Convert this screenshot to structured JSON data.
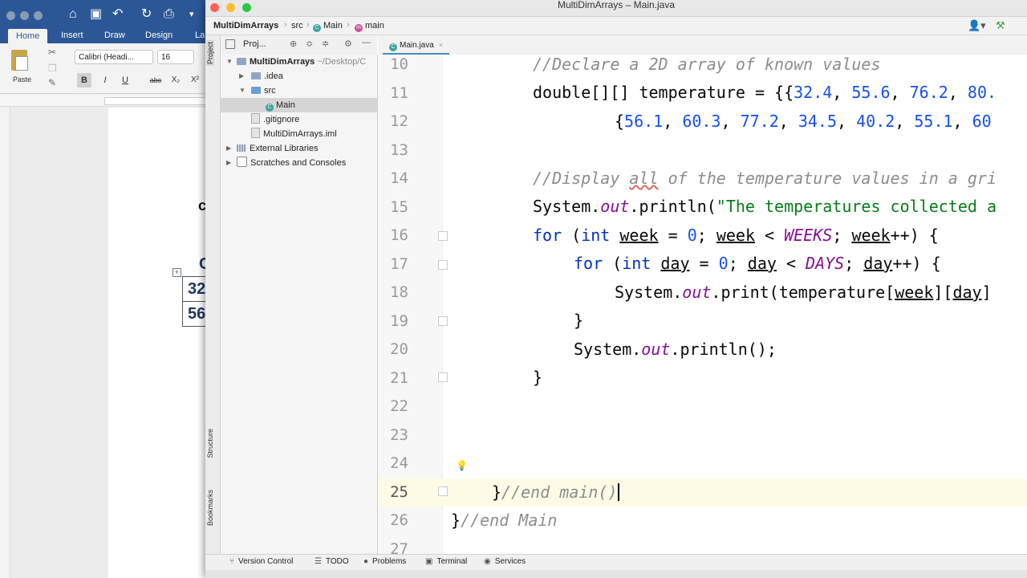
{
  "word": {
    "tabs": [
      "Home",
      "Insert",
      "Draw",
      "Design",
      "La"
    ],
    "paste_label": "Paste",
    "font_name": "Calibri (Headi...",
    "font_size": "16",
    "format_buttons": [
      "B",
      "I",
      "U",
      "abc",
      "X₂",
      "X²"
    ],
    "doc_char": "c",
    "doc_heading_partial": "C",
    "table_cells": [
      "32",
      "56"
    ]
  },
  "ide": {
    "window_title": "MultiDimArrays – Main.java",
    "breadcrumb": {
      "project": "MultiDimArrays",
      "folder": "src",
      "class": "Main",
      "method": "main"
    },
    "side_tabs": [
      "Project",
      "Structure",
      "Bookmarks"
    ],
    "project_header": "Proj...",
    "tree": [
      {
        "label": "MultiDimArrays",
        "path": "~/Desktop/C"
      },
      {
        "label": ".idea"
      },
      {
        "label": "src"
      },
      {
        "label": "Main"
      },
      {
        "label": ".gitignore"
      },
      {
        "label": "MultiDimArrays.iml"
      },
      {
        "label": "External Libraries"
      },
      {
        "label": "Scratches and Consoles"
      }
    ],
    "editor_tab": "Main.java",
    "line_numbers": [
      "10",
      "11",
      "12",
      "13",
      "14",
      "15",
      "16",
      "17",
      "18",
      "19",
      "20",
      "21",
      "22",
      "23",
      "24",
      "25",
      "26",
      "27"
    ],
    "code": {
      "l10": "//Declare a 2D array of known values",
      "l11_type": "double[][] temperature = {{",
      "l11_values": [
        "32.4",
        "55.6",
        "76.2",
        "80."
      ],
      "l12_values": [
        "56.1",
        "60.3",
        "77.2",
        "34.5",
        "40.2",
        "55.1",
        "60"
      ],
      "l14_a": "//Display ",
      "l14_all": "all",
      "l14_b": " of the temperature values in a gri",
      "l15_a": "System.",
      "l15_out": "out",
      "l15_b": ".println(",
      "l15_str": "\"The temperatures collected a",
      "l16_for": "for",
      "l16_int": "int",
      "l16_var": "week",
      "l16_zero": "0",
      "l16_const": "WEEKS",
      "l17_var": "day",
      "l17_const": "DAYS",
      "l18_a": "System.",
      "l18_out": "out",
      "l18_b": ".print(temperature[",
      "l18_week": "week",
      "l18_day": "day",
      "l20_a": "System.",
      "l20_out": "out",
      "l20_b": ".println();",
      "l21": "}",
      "l25_brace": "}",
      "l25_comment": "//end main()",
      "l26_brace": "}",
      "l26_comment": "//end Main"
    },
    "status": [
      "Version Control",
      "TODO",
      "Problems",
      "Terminal",
      "Services"
    ]
  }
}
